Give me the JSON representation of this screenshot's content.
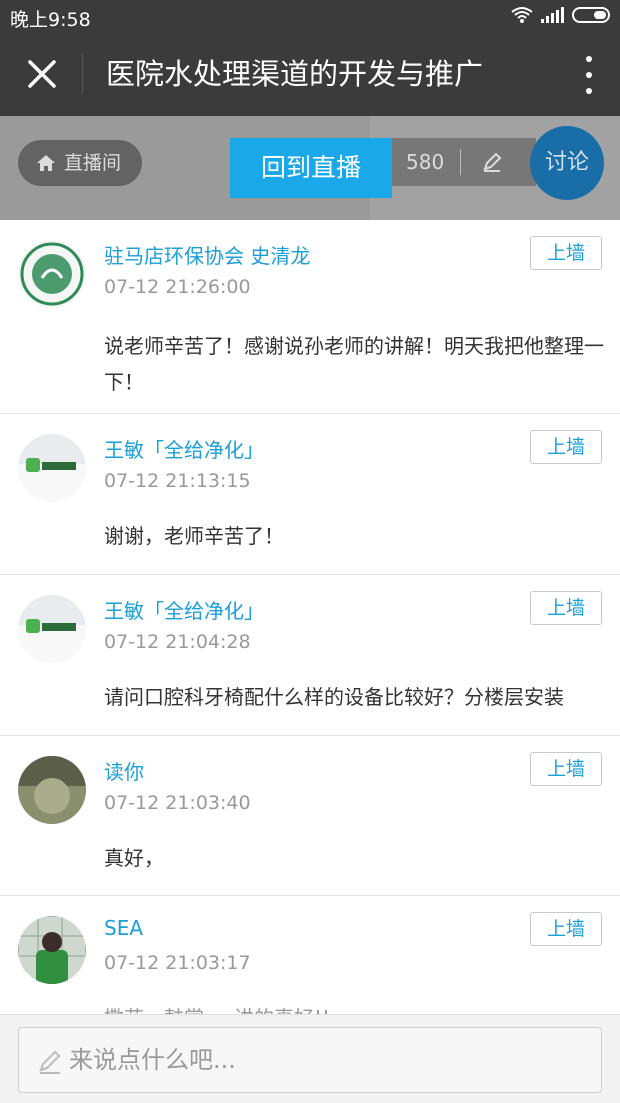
{
  "statusbar": {
    "time": "晚上9:58"
  },
  "header": {
    "title": "医院水处理渠道的开发与推广"
  },
  "live": {
    "room_label": "直播间",
    "back_to_live": "回到直播",
    "viewer_count": "580",
    "discuss_label": "讨论"
  },
  "comments": [
    {
      "name": "驻马店环保协会 史清龙",
      "time": "07-12 21:26:00",
      "text": "说老师辛苦了！感谢说孙老师的讲解！明天我把他整理一下！",
      "wall_label": "上墙"
    },
    {
      "name": "王敏「全给净化」",
      "time": "07-12 21:13:15",
      "text": "谢谢，老师辛苦了！",
      "wall_label": "上墙"
    },
    {
      "name": "王敏「全给净化」",
      "time": "07-12 21:04:28",
      "text": "请问口腔科牙椅配什么样的设备比较好？分楼层安装",
      "wall_label": "上墙"
    },
    {
      "name": "读你",
      "time": "07-12 21:03:40",
      "text": "真好，",
      "wall_label": "上墙"
    },
    {
      "name": "SEA",
      "time": "07-12 21:03:17",
      "text": "撒花，鼓掌，，讲的真好!!",
      "wall_label": "上墙"
    }
  ],
  "composer": {
    "placeholder": "来说点什么吧..."
  },
  "colors": {
    "accent": "#1ba8e8",
    "link": "#1b9fd6",
    "bar": "#3b3b3b"
  }
}
